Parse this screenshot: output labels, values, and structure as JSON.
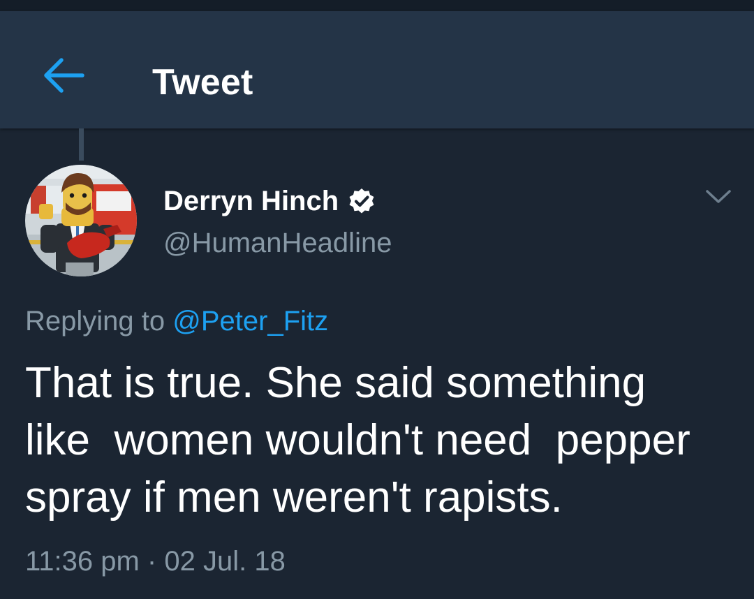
{
  "header": {
    "title": "Tweet",
    "back_icon": "back-arrow-icon"
  },
  "colors": {
    "background": "#1b2532",
    "header_background": "#243447",
    "accent": "#1da1f2",
    "secondary_text": "#8899a6",
    "primary_text": "#ffffff"
  },
  "tweet": {
    "author": {
      "display_name": "Derryn Hinch",
      "handle": "@HumanHeadline",
      "verified": true,
      "verified_icon": "verified-badge-icon",
      "avatar_icon": "lego-figure-avatar"
    },
    "more_icon": "chevron-down-icon",
    "reply": {
      "prefix": "Replying to",
      "mention": "@Peter_Fitz"
    },
    "text_lines": [
      "That is true. She said something",
      "like  women wouldn't need  pepper",
      "spray if men weren't rapists."
    ],
    "timestamp": "11:36 pm · 02 Jul. 18"
  }
}
